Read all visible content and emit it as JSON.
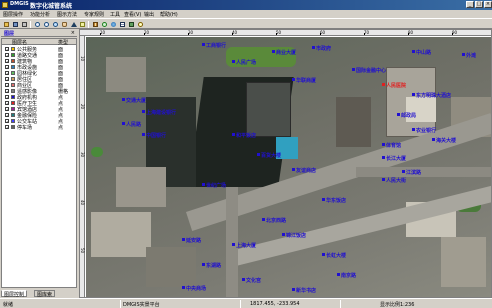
{
  "window": {
    "brand": "DMGIS",
    "title": "数字化城管系统",
    "minimize": "_",
    "maximize": "□",
    "close": "×"
  },
  "menu": [
    "图层操作",
    "功能分析",
    "图示方法",
    "专家规则",
    "工具",
    "查看(V)",
    "输出",
    "帮助(H)"
  ],
  "toolbar": {
    "icons": [
      "open-icon",
      "save-icon",
      "print-icon",
      "zoom-in-icon",
      "zoom-out-icon",
      "zoom-full-icon",
      "pan-icon",
      "select-icon",
      "identify-icon",
      "measure-icon",
      "refresh-icon",
      "globe-icon",
      "table-icon",
      "layer-icon",
      "help-icon"
    ]
  },
  "layer_panel": {
    "header": "图层",
    "close": "×",
    "col_name": "图层名",
    "col_type": "类型",
    "layers": [
      {
        "name": "公共服务",
        "type": "面",
        "color": "#f0c000",
        "checked": true
      },
      {
        "name": "道路交通",
        "type": "面",
        "color": "#30a030",
        "checked": true
      },
      {
        "name": "建筑物",
        "type": "面",
        "color": "#c05030",
        "checked": true
      },
      {
        "name": "市政设施",
        "type": "面",
        "color": "#3080c0",
        "checked": true
      },
      {
        "name": "园林绿化",
        "type": "面",
        "color": "#60c060",
        "checked": true
      },
      {
        "name": "居住区",
        "type": "面",
        "color": "#d0a060",
        "checked": true
      },
      {
        "name": "商业区",
        "type": "面",
        "color": "#e07070",
        "checked": true
      },
      {
        "name": "遥感影像",
        "type": "栅格",
        "color": "#808080",
        "checked": true
      },
      {
        "name": "政府机构",
        "type": "点",
        "color": "#2010d0",
        "checked": true
      },
      {
        "name": "医疗卫生",
        "type": "点",
        "color": "#e02020",
        "checked": true
      },
      {
        "name": "宾馆酒店",
        "type": "点",
        "color": "#a020a0",
        "checked": true
      },
      {
        "name": "金融保险",
        "type": "点",
        "color": "#208080",
        "checked": true
      },
      {
        "name": "公交车站",
        "type": "点",
        "color": "#4040ff",
        "checked": true
      },
      {
        "name": "停车场",
        "type": "点",
        "color": "#606060",
        "checked": true
      }
    ],
    "tabs": [
      "图层控制",
      "图库索"
    ]
  },
  "ruler": {
    "top_ticks": [
      "10",
      "20",
      "30",
      "40",
      "50",
      "60",
      "70",
      "80",
      "90"
    ],
    "left_ticks": [
      "10",
      "20",
      "30",
      "40",
      "50"
    ]
  },
  "map": {
    "labels": [
      {
        "text": "工商银行",
        "color": "blue"
      },
      {
        "text": "商业大厦",
        "color": "blue"
      },
      {
        "text": "市政府",
        "color": "blue"
      },
      {
        "text": "人民广场",
        "color": "blue"
      },
      {
        "text": "国际金融中心",
        "color": "blue"
      },
      {
        "text": "华联商厦",
        "color": "blue"
      },
      {
        "text": "中山路",
        "color": "blue"
      },
      {
        "text": "人民医院",
        "color": "red"
      },
      {
        "text": "交通大厦",
        "color": "blue"
      },
      {
        "text": "上海建设银行",
        "color": "blue"
      },
      {
        "text": "人民路",
        "color": "blue"
      },
      {
        "text": "东方明珠大酒店",
        "color": "blue"
      },
      {
        "text": "中国银行",
        "color": "blue"
      },
      {
        "text": "和平饭店",
        "color": "blue"
      },
      {
        "text": "百货大楼",
        "color": "blue"
      },
      {
        "text": "友谊商店",
        "color": "blue"
      },
      {
        "text": "世纪广场",
        "color": "blue"
      },
      {
        "text": "邮政局",
        "color": "blue"
      },
      {
        "text": "农业银行",
        "color": "blue"
      },
      {
        "text": "体育馆",
        "color": "blue"
      },
      {
        "text": "长江大厦",
        "color": "blue"
      },
      {
        "text": "江滨路",
        "color": "blue"
      },
      {
        "text": "人民大街",
        "color": "blue"
      },
      {
        "text": "北京西路",
        "color": "blue"
      },
      {
        "text": "锦江饭店",
        "color": "blue"
      },
      {
        "text": "延安路",
        "color": "blue"
      },
      {
        "text": "上海大厦",
        "color": "blue"
      },
      {
        "text": "长虹大楼",
        "color": "blue"
      },
      {
        "text": "东湖路",
        "color": "blue"
      },
      {
        "text": "文化宫",
        "color": "blue"
      },
      {
        "text": "中央商场",
        "color": "blue"
      },
      {
        "text": "新华书店",
        "color": "blue"
      },
      {
        "text": "南京路",
        "color": "blue"
      },
      {
        "text": "海关大楼",
        "color": "blue"
      },
      {
        "text": "外滩",
        "color": "blue"
      },
      {
        "text": "华东饭店",
        "color": "blue"
      }
    ]
  },
  "status": {
    "ready": "就绪",
    "version": "DMGIS实景平台",
    "coords": "1817.455, -233.954",
    "scale": "显示比例1:236"
  }
}
